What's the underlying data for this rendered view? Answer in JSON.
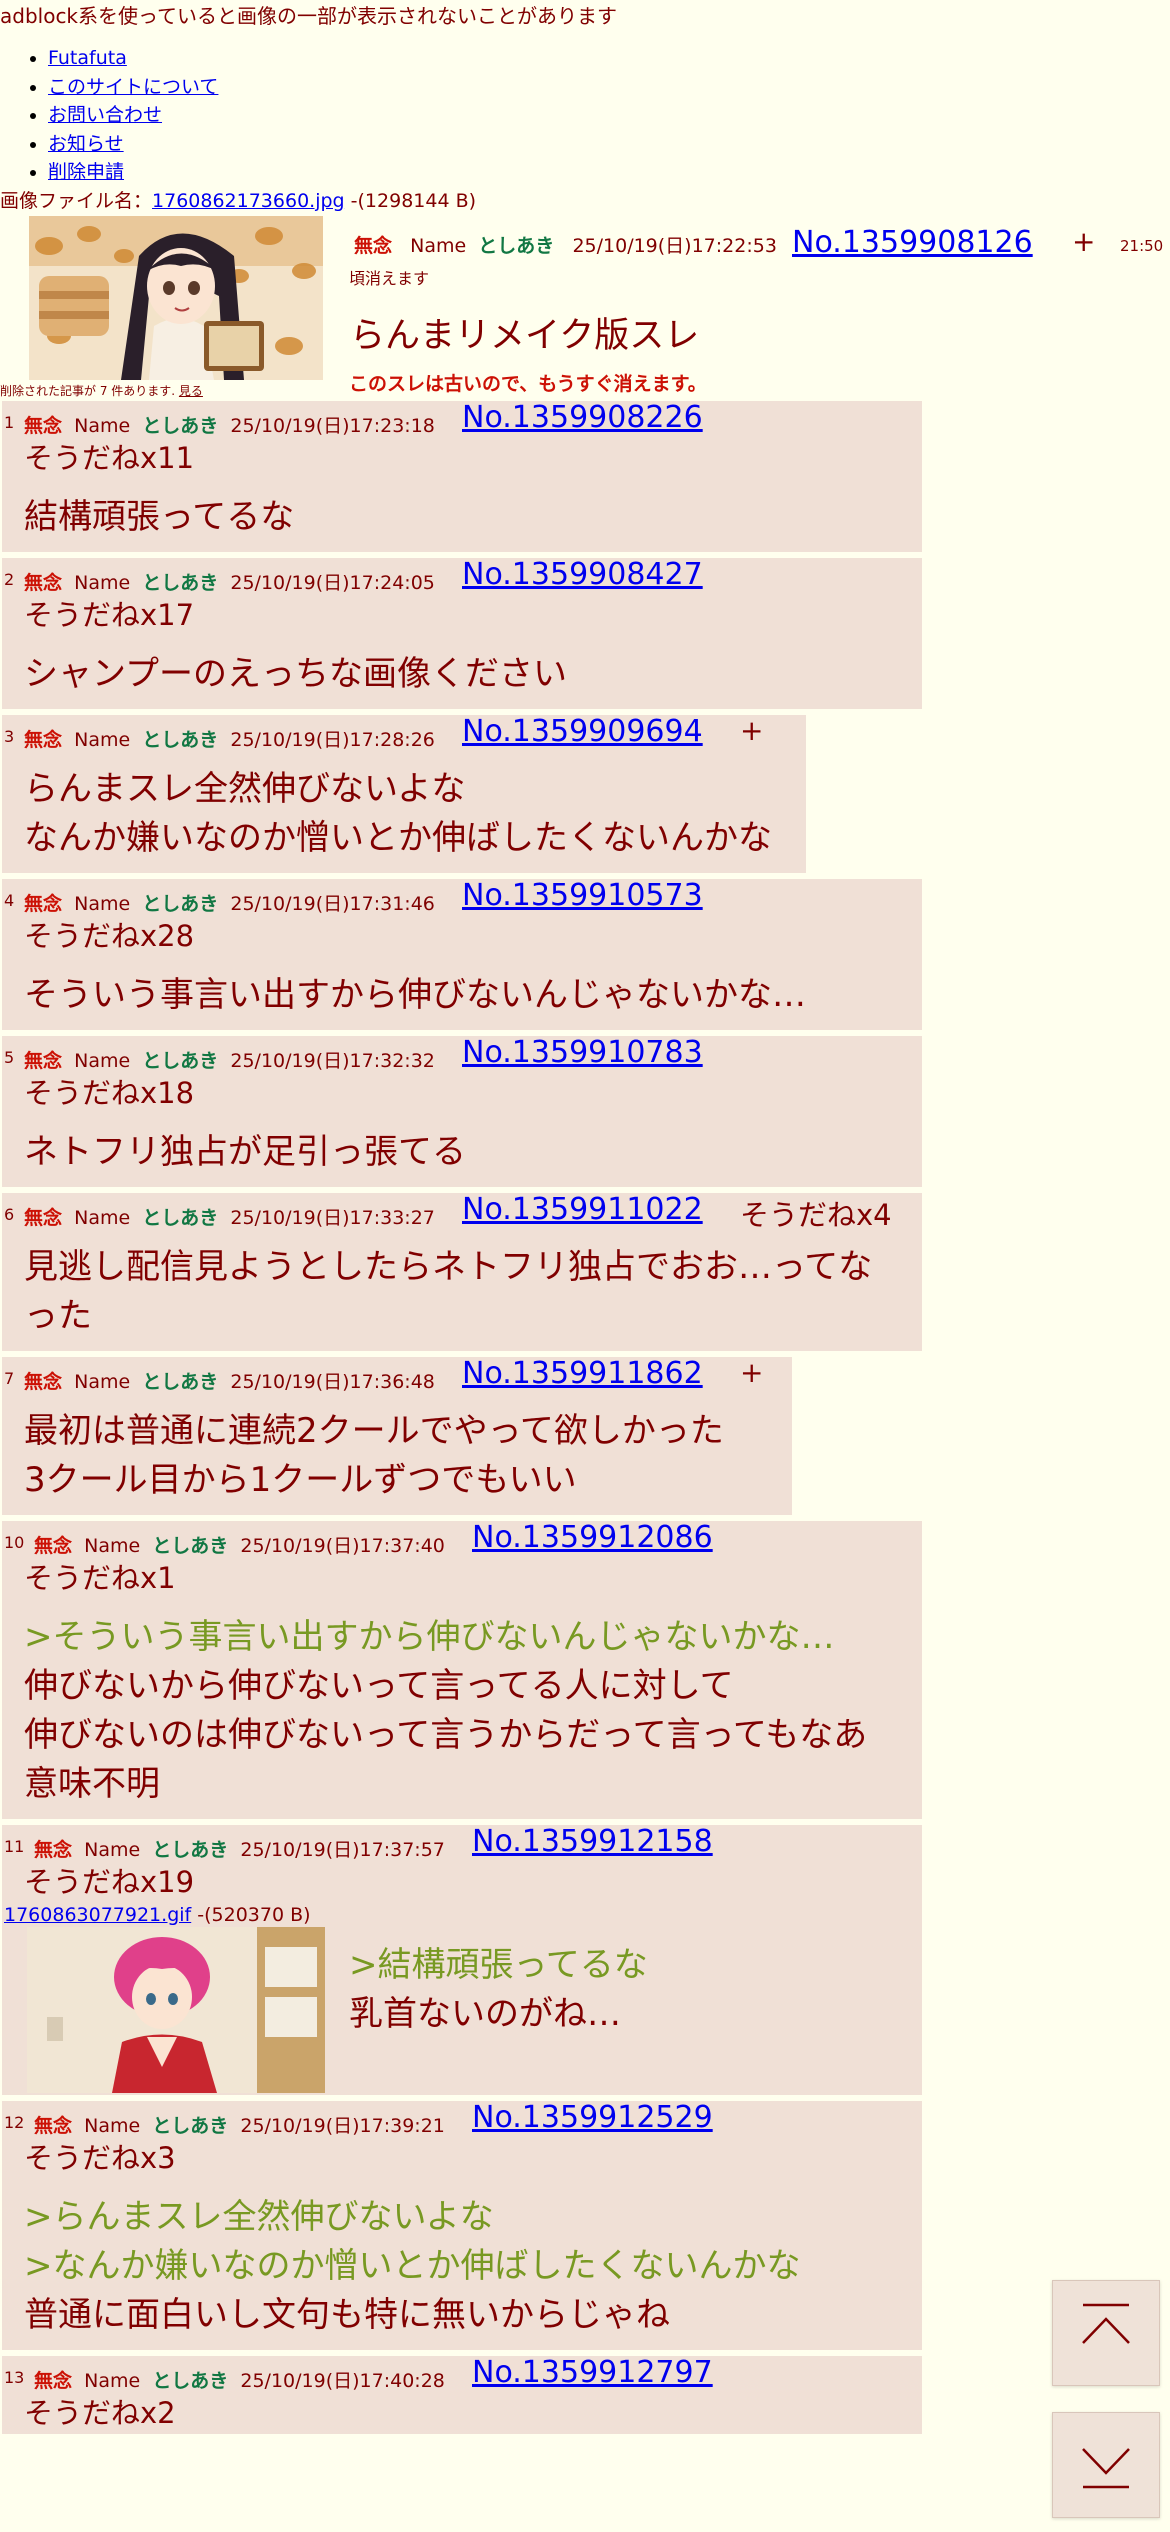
{
  "notice": "adblock系を使っていると画像の一部が表示されないことがあります",
  "nav": [
    "Futafuta",
    "このサイトについて",
    "お問い合わせ",
    "お知らせ",
    "削除申請"
  ],
  "op": {
    "file_label": "画像ファイル名：",
    "file_name": "1760862173660.jpg",
    "file_size": "-(1298144 B)",
    "subject": "無念",
    "name_label": "Name",
    "name": "としあき",
    "datetime": "25/10/19(日)17:22:53",
    "no": "No.1359908126",
    "plus": "+",
    "expire_time": "21:50",
    "expire_note": "頃消えます",
    "body": "らんまリメイク版スレ",
    "warning": "このスレは古いので、もうすぐ消えます。"
  },
  "deleted": {
    "text": "削除された記事が 7 件あります.",
    "link": "見る"
  },
  "replies": [
    {
      "num": "1",
      "subject": "無念",
      "name_label": "Name",
      "name": "としあき",
      "datetime": "25/10/19(日)17:23:18",
      "no": "No.1359908226",
      "sodane": "そうだねx11",
      "lines": [
        {
          "t": "結構頑張ってるな",
          "q": false
        }
      ]
    },
    {
      "num": "2",
      "subject": "無念",
      "name_label": "Name",
      "name": "としあき",
      "datetime": "25/10/19(日)17:24:05",
      "no": "No.1359908427",
      "sodane": "そうだねx17",
      "lines": [
        {
          "t": "シャンプーのえっちな画像ください",
          "q": false
        }
      ]
    },
    {
      "num": "3",
      "subject": "無念",
      "name_label": "Name",
      "name": "としあき",
      "datetime": "25/10/19(日)17:28:26",
      "no": "No.1359909694",
      "plus": "+",
      "lines": [
        {
          "t": "らんまスレ全然伸びないよな",
          "q": false
        },
        {
          "t": "なんか嫌いなのか憎いとか伸ばしたくないんかな",
          "q": false
        }
      ]
    },
    {
      "num": "4",
      "subject": "無念",
      "name_label": "Name",
      "name": "としあき",
      "datetime": "25/10/19(日)17:31:46",
      "no": "No.1359910573",
      "sodane": "そうだねx28",
      "lines": [
        {
          "t": "そういう事言い出すから伸びないんじゃないかな…",
          "q": false
        }
      ]
    },
    {
      "num": "5",
      "subject": "無念",
      "name_label": "Name",
      "name": "としあき",
      "datetime": "25/10/19(日)17:32:32",
      "no": "No.1359910783",
      "sodane": "そうだねx18",
      "lines": [
        {
          "t": "ネトフリ独占が足引っ張てる",
          "q": false
        }
      ]
    },
    {
      "num": "6",
      "subject": "無念",
      "name_label": "Name",
      "name": "としあき",
      "datetime": "25/10/19(日)17:33:27",
      "no": "No.1359911022",
      "inline_sodane": "そうだねx4",
      "lines": [
        {
          "t": "見逃し配信見ようとしたらネトフリ独占でおお…ってな",
          "q": false
        },
        {
          "t": "った",
          "q": false
        }
      ]
    },
    {
      "num": "7",
      "subject": "無念",
      "name_label": "Name",
      "name": "としあき",
      "datetime": "25/10/19(日)17:36:48",
      "no": "No.1359911862",
      "plus": "+",
      "lines": [
        {
          "t": "最初は普通に連続2クールでやって欲しかった",
          "q": false
        },
        {
          "t": "3クール目から1クールずつでもいい",
          "q": false
        }
      ]
    },
    {
      "num": "10",
      "subject": "無念",
      "name_label": "Name",
      "name": "としあき",
      "datetime": "25/10/19(日)17:37:40",
      "no": "No.1359912086",
      "sodane": "そうだねx1",
      "lines": [
        {
          "t": ">そういう事言い出すから伸びないんじゃないかな…",
          "q": true
        },
        {
          "t": "伸びないから伸びないって言ってる人に対して",
          "q": false
        },
        {
          "t": "伸びないのは伸びないって言うからだって言ってもなあ",
          "q": false
        },
        {
          "t": "意味不明",
          "q": false
        }
      ]
    },
    {
      "num": "11",
      "subject": "無念",
      "name_label": "Name",
      "name": "としあき",
      "datetime": "25/10/19(日)17:37:57",
      "no": "No.1359912158",
      "sodane": "そうだねx19",
      "file_name": "1760863077921.gif",
      "file_size": "-(520370 B)",
      "lines": [
        {
          "t": ">結構頑張ってるな",
          "q": true
        },
        {
          "t": "乳首ないのがね…",
          "q": false
        }
      ]
    },
    {
      "num": "12",
      "subject": "無念",
      "name_label": "Name",
      "name": "としあき",
      "datetime": "25/10/19(日)17:39:21",
      "no": "No.1359912529",
      "sodane": "そうだねx3",
      "lines": [
        {
          "t": ">らんまスレ全然伸びないよな",
          "q": true
        },
        {
          "t": ">なんか嫌いなのか憎いとか伸ばしたくないんかな",
          "q": true
        },
        {
          "t": "普通に面白いし文句も特に無いからじゃね",
          "q": false
        }
      ]
    },
    {
      "num": "13",
      "subject": "無念",
      "name_label": "Name",
      "name": "としあき",
      "datetime": "25/10/19(日)17:40:28",
      "no": "No.1359912797",
      "sodane": "そうだねx2",
      "lines": []
    }
  ],
  "colors": {
    "background": "#ffffee",
    "reply_bg": "#f0e0d6",
    "text": "#800000",
    "subject": "#cc1105",
    "name": "#117743",
    "quote": "#789922",
    "link": "#0000ee"
  },
  "icons": {
    "scroll_top": "chevron-up-icon",
    "scroll_bottom": "chevron-down-icon"
  }
}
